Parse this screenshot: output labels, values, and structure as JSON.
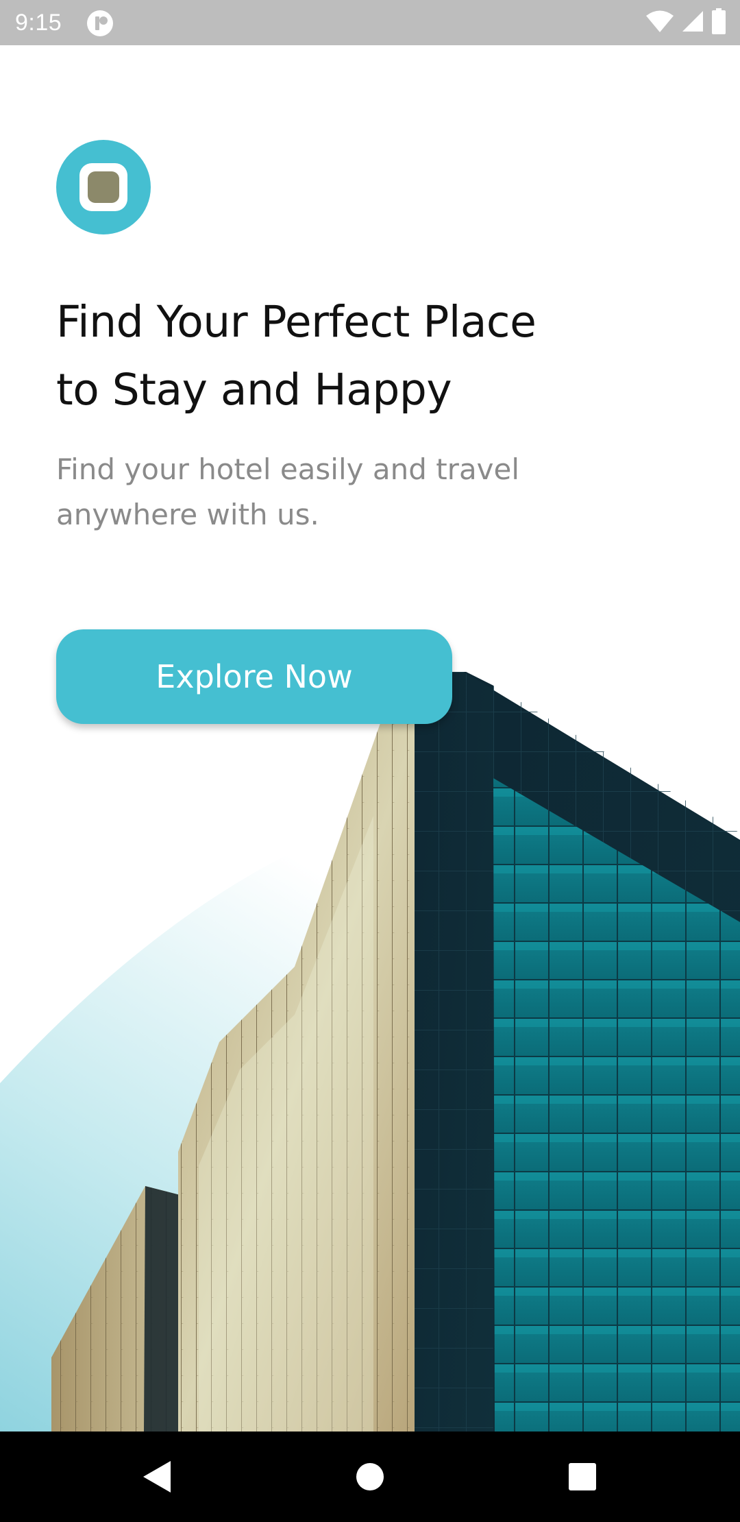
{
  "status_bar": {
    "time": "9:15",
    "icons": [
      "app-notification-icon",
      "wifi-icon",
      "cell-signal-icon",
      "battery-icon"
    ]
  },
  "logo": {
    "icon": "app-logo-icon"
  },
  "hero": {
    "headline_line1": "Find Your Perfect Place",
    "headline_line2": "to Stay and Happy",
    "subtitle_line1": "Find your hotel easily and travel",
    "subtitle_line2": "anywhere with us."
  },
  "cta": {
    "label": "Explore Now"
  },
  "illustration": {
    "icon": "building-image"
  },
  "nav_bar": {
    "icons": [
      "back-icon",
      "home-icon",
      "recents-icon"
    ]
  },
  "colors": {
    "accent": "#45bfd1",
    "status_bar": "#bdbdbd",
    "heading": "#111111",
    "subtitle": "#8a8a8a",
    "logo_core": "#8c896a"
  }
}
